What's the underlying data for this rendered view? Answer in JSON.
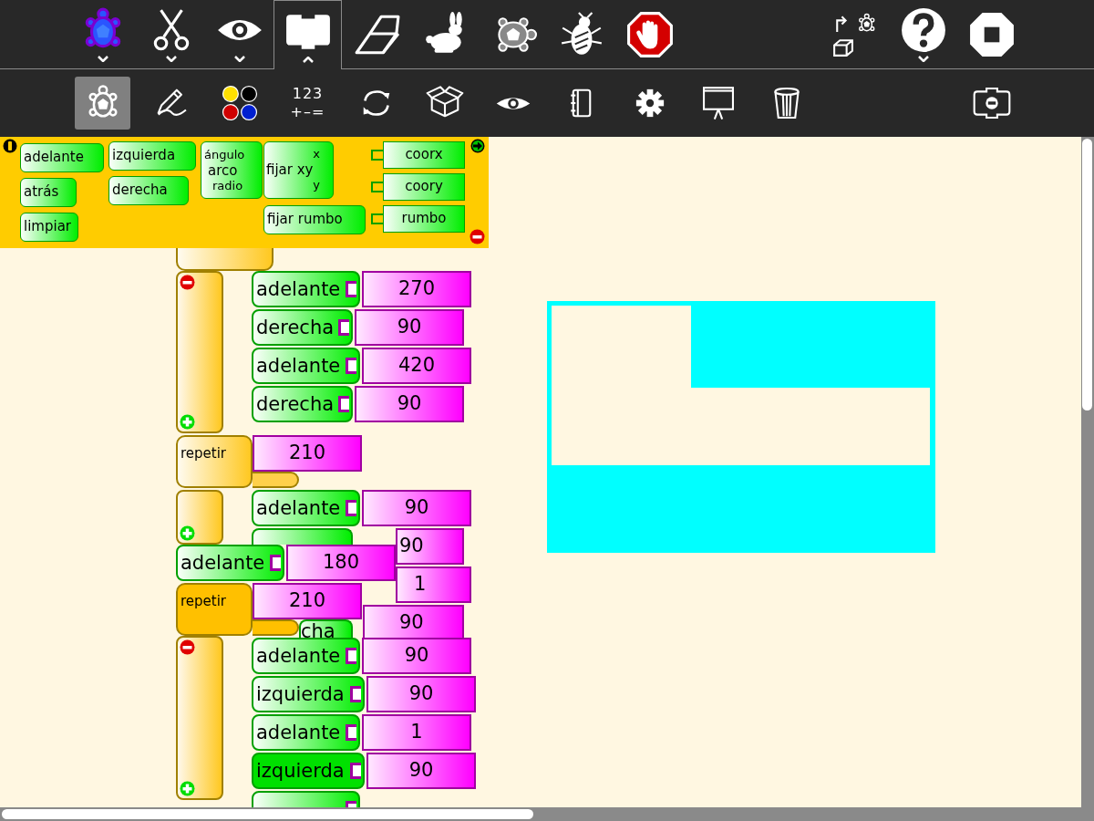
{
  "toolbar": {
    "left": [
      {
        "kind": "activity",
        "menu": true,
        "expanded": false
      },
      {
        "kind": "edit",
        "menu": true,
        "expanded": false
      },
      {
        "kind": "view",
        "menu": true,
        "expanded": false
      },
      {
        "kind": "blocks",
        "menu": true,
        "expanded": true
      },
      {
        "kind": "eraser",
        "menu": false
      },
      {
        "kind": "rabbit",
        "menu": false
      },
      {
        "kind": "slow",
        "menu": false
      },
      {
        "kind": "bug",
        "menu": false
      },
      {
        "kind": "halt",
        "menu": false
      }
    ],
    "right": [
      {
        "kind": "share",
        "menu": false
      },
      {
        "kind": "help",
        "menu": true,
        "expanded": false
      },
      {
        "kind": "stop",
        "menu": false
      }
    ]
  },
  "palette_bar": {
    "left": [
      {
        "kind": "turtle",
        "selected": true
      },
      {
        "kind": "pen",
        "selected": false
      },
      {
        "kind": "colors",
        "selected": false
      },
      {
        "kind": "numbers",
        "lines": [
          "123",
          "+–="
        ],
        "selected": false
      },
      {
        "kind": "flow",
        "selected": false
      },
      {
        "kind": "box",
        "selected": false
      },
      {
        "kind": "eye",
        "selected": false
      },
      {
        "kind": "journal",
        "selected": false
      },
      {
        "kind": "gear",
        "selected": false
      },
      {
        "kind": "presentation",
        "selected": false
      },
      {
        "kind": "trash",
        "selected": false
      }
    ],
    "right": [
      {
        "kind": "collapse",
        "selected": false
      }
    ]
  },
  "palette": {
    "blocks": [
      {
        "kind": "command",
        "label": "adelante"
      },
      {
        "kind": "command",
        "label": "atrás"
      },
      {
        "kind": "command",
        "label": "limpiar"
      },
      {
        "kind": "command",
        "label": "izquierda"
      },
      {
        "kind": "command",
        "label": "derecha"
      },
      {
        "kind": "arc",
        "labels": [
          "ángulo",
          "arco",
          "radio"
        ]
      },
      {
        "kind": "setxy",
        "labels": [
          "x",
          "fijar xy",
          "y"
        ]
      },
      {
        "kind": "command",
        "label": "fijar rumbo"
      },
      {
        "kind": "reporter",
        "label": "coorx"
      },
      {
        "kind": "reporter",
        "label": "coory"
      },
      {
        "kind": "reporter",
        "label": "rumbo"
      }
    ]
  },
  "canvas": {
    "blocks": [
      {
        "kind": "repeat",
        "highlighted": false
      },
      {
        "kind": "clamp",
        "collapsible": true
      },
      {
        "kind": "command",
        "label": "adelante",
        "value": "270",
        "highlighted": false
      },
      {
        "kind": "command",
        "label": "derecha",
        "value": "90",
        "highlighted": false
      },
      {
        "kind": "command",
        "label": "adelante",
        "value": "420",
        "highlighted": false
      },
      {
        "kind": "command",
        "label": "derecha",
        "value": "90",
        "highlighted": false
      },
      {
        "kind": "repeat",
        "label": "repetir",
        "value": "210",
        "highlighted": false
      },
      {
        "kind": "command",
        "label": "adelante",
        "value": "90",
        "highlighted": false
      },
      {
        "kind": "clamp",
        "collapsible": false
      },
      {
        "kind": "command",
        "value": "90",
        "highlighted": false
      },
      {
        "kind": "command",
        "label": "adelante",
        "value": "180",
        "highlighted": false
      },
      {
        "kind": "command",
        "value": "1"
      },
      {
        "kind": "repeat",
        "label": "repetir",
        "value": "210",
        "highlighted": true
      },
      {
        "kind": "command",
        "label": "cha",
        "value": "90",
        "highlighted": false
      },
      {
        "kind": "clamp",
        "collapsible": true
      },
      {
        "kind": "command",
        "label": "adelante",
        "value": "90",
        "highlighted": false
      },
      {
        "kind": "command",
        "label": "izquierda",
        "value": "90",
        "highlighted": false
      },
      {
        "kind": "command",
        "label": "adelante",
        "value": "1",
        "highlighted": false
      },
      {
        "kind": "command",
        "label": "izquierda",
        "value": "90",
        "highlighted": true
      },
      {
        "kind": "command",
        "highlighted": false
      }
    ]
  }
}
